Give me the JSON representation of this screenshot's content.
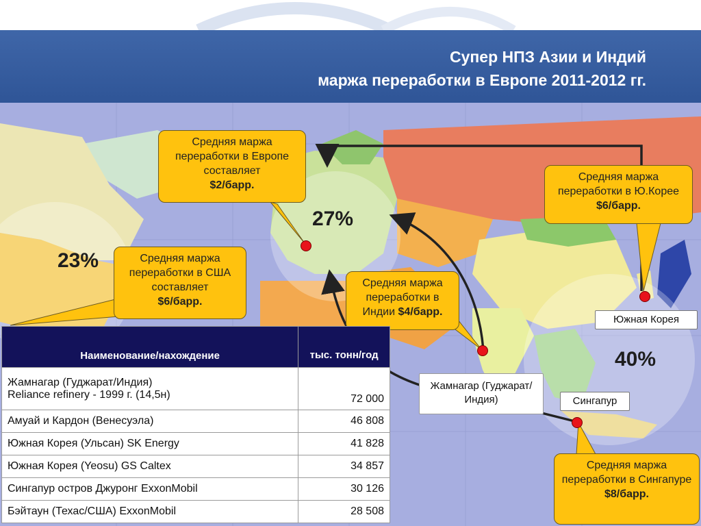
{
  "title": {
    "line1": "Супер НПЗ Азии и Индий",
    "line2": "маржа переработки в Европе 2011-2012 гг."
  },
  "callouts": {
    "europe": {
      "text": "Средняя маржа переработки в Европе составляет",
      "value": "$2/барр."
    },
    "usa": {
      "text": "Средняя маржа переработки в США составляет",
      "value": "$6/барр."
    },
    "india": {
      "text": "Средняя маржа переработки в Индии",
      "value": "$4/барр."
    },
    "korea": {
      "text": "Средняя маржа переработки в Ю.Корее",
      "value": "$6/барр."
    },
    "singapore": {
      "text": "Средняя маржа переработки в Сингапуре",
      "value": "$8/барр."
    }
  },
  "percentages": {
    "europe": "27%",
    "usa": "23%",
    "asia": "40%"
  },
  "place_labels": {
    "south_korea": "Южная Корея",
    "jamnagar": "Жамнагар (Гуджарат/Индия)",
    "singapore": "Сингапур"
  },
  "table": {
    "headers": {
      "name": "Наименование/нахождение",
      "capacity": "тыс. тонн/год"
    },
    "rows": [
      {
        "name_line1": "Жамнагар (Гуджарат/Индия)",
        "name_line2": "Reliance refinery - 1999 г. (14,5н)",
        "capacity": "72 000"
      },
      {
        "name": "Амуай и Кардон (Венесуэла)",
        "capacity": "46 808"
      },
      {
        "name": "Южная Корея (Ульсан) SK Energy",
        "capacity": "41 828"
      },
      {
        "name": "Южная Корея (Yeosu) GS Caltex",
        "capacity": "34 857"
      },
      {
        "name": "Сингапур остров Джуронг ExxonMobil",
        "capacity": "30 126"
      },
      {
        "name": "Бэйтаун (Техас/США) ExxonMobil",
        "capacity": "28 508"
      }
    ]
  },
  "colors": {
    "header_band": "#2f5597",
    "callout_fill": "#ffc20e",
    "marker": "#e8141b",
    "table_header": "#13125a"
  }
}
